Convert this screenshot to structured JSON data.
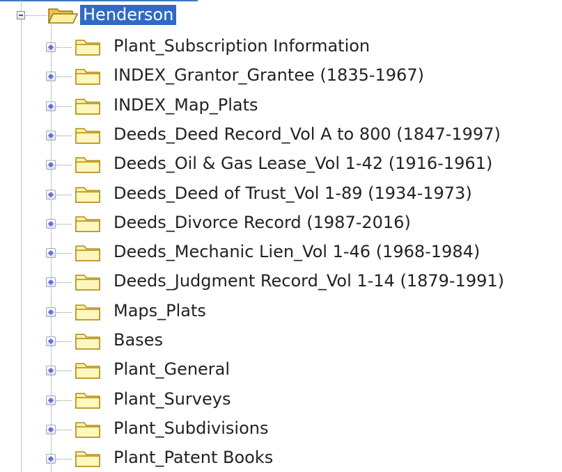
{
  "tree": {
    "root": {
      "label": "Henderson",
      "expanded": true,
      "selected": true,
      "icon": "folder-open-icon"
    },
    "children": [
      {
        "label": "Plant_Subscription Information",
        "icon": "folder-icon"
      },
      {
        "label": "INDEX_Grantor_Grantee (1835-1967)",
        "icon": "folder-icon"
      },
      {
        "label": "INDEX_Map_Plats",
        "icon": "folder-icon"
      },
      {
        "label": "Deeds_Deed Record_Vol A to 800 (1847-1997)",
        "icon": "folder-icon"
      },
      {
        "label": "Deeds_Oil & Gas Lease_Vol 1-42 (1916-1961)",
        "icon": "folder-icon"
      },
      {
        "label": "Deeds_Deed of Trust_Vol 1-89 (1934-1973)",
        "icon": "folder-icon"
      },
      {
        "label": "Deeds_Divorce Record (1987-2016)",
        "icon": "folder-icon"
      },
      {
        "label": "Deeds_Mechanic Lien_Vol 1-46 (1968-1984)",
        "icon": "folder-icon"
      },
      {
        "label": "Deeds_Judgment Record_Vol 1-14 (1879-1991)",
        "icon": "folder-icon"
      },
      {
        "label": "Maps_Plats",
        "icon": "folder-icon"
      },
      {
        "label": "Bases",
        "icon": "folder-icon"
      },
      {
        "label": "Plant_General",
        "icon": "folder-icon"
      },
      {
        "label": "Plant_Surveys",
        "icon": "folder-icon"
      },
      {
        "label": "Plant_Subdivisions",
        "icon": "folder-icon"
      },
      {
        "label": "Plant_Patent Books",
        "icon": "folder-icon"
      }
    ]
  },
  "colors": {
    "selection": "#316ac5",
    "folder_fill": "#fff3a0",
    "folder_stroke": "#b08a10",
    "expander_diamond": "#6b6bdc"
  }
}
